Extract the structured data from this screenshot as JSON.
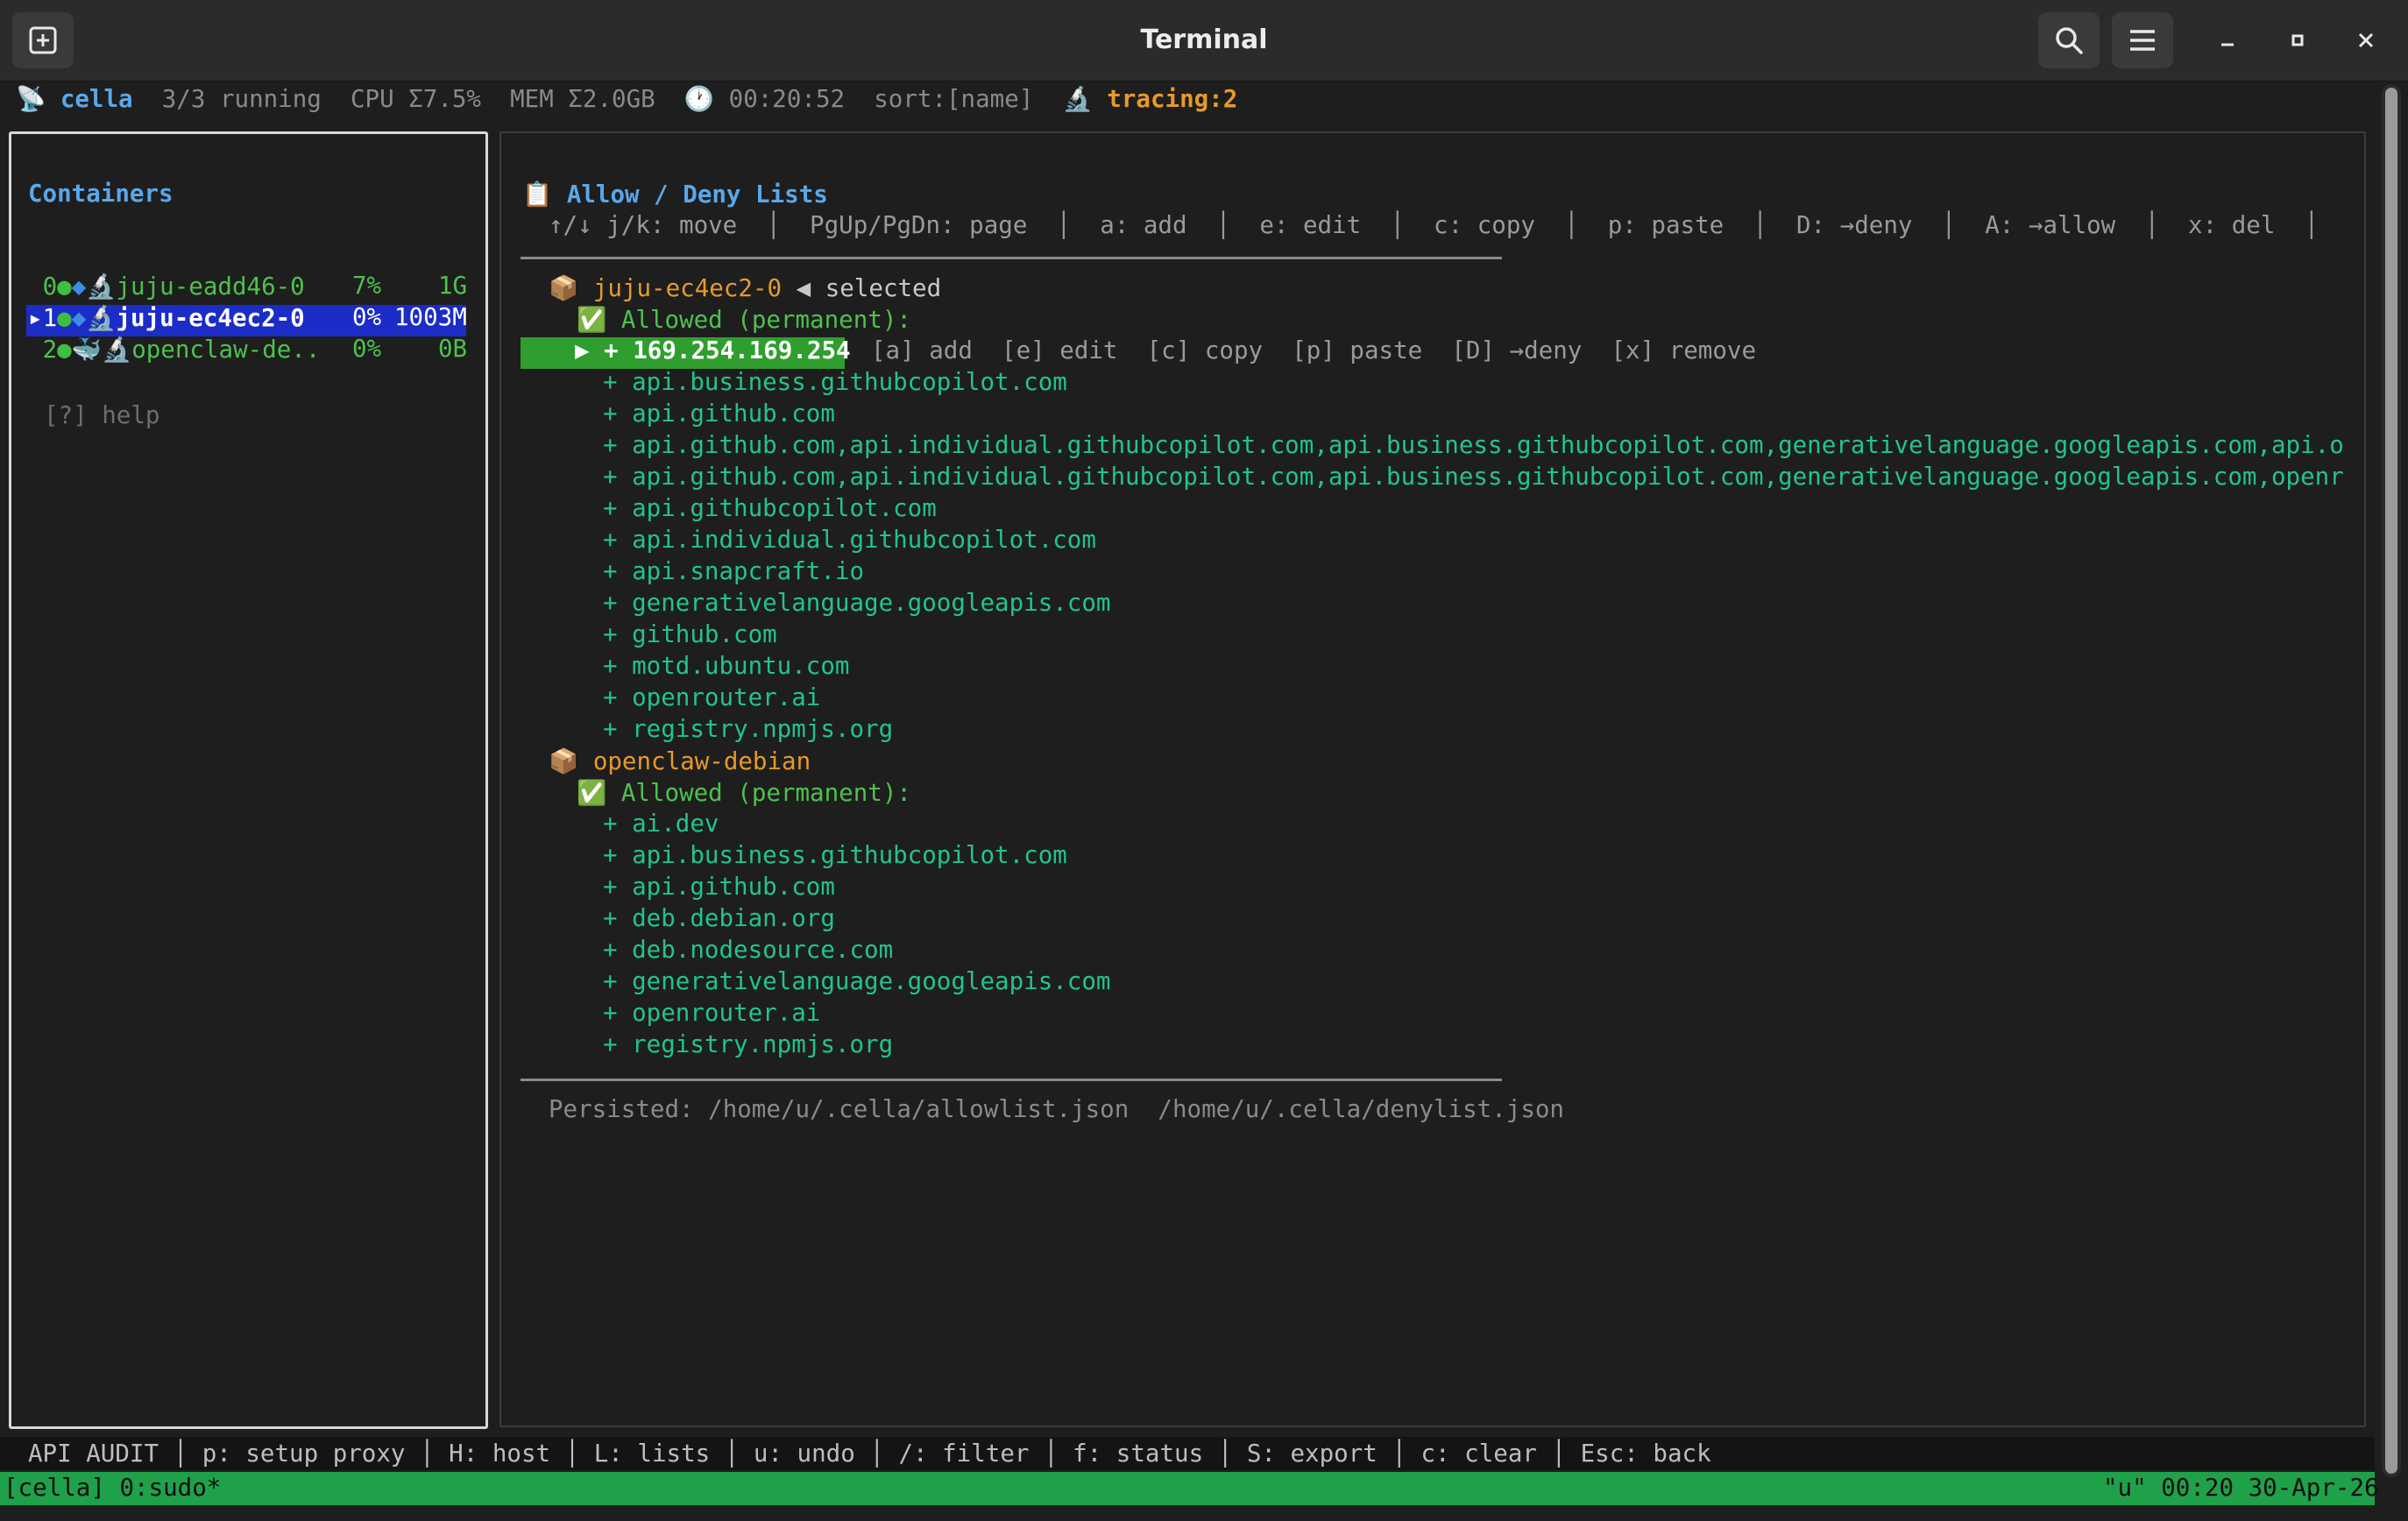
{
  "window": {
    "title": "Terminal",
    "new_tab_icon": "new-tab-icon",
    "search_icon": "search-icon",
    "menu_icon": "hamburger-menu-icon",
    "minimize_icon": "minimize-icon",
    "maximize_icon": "maximize-icon",
    "close_icon": "close-icon"
  },
  "status": {
    "app_icon": "📡",
    "app": "cella",
    "running": "3/3 running",
    "cpu": "CPU Σ7.5%",
    "mem": "MEM Σ2.0GB",
    "clock_icon": "🕐",
    "uptime": "00:20:52",
    "sort": "sort:[name]",
    "tracing_icon": "🔬",
    "tracing": "tracing:2"
  },
  "sidebar": {
    "title": "Containers",
    "containers": [
      {
        "index": "0",
        "name": "juju-eadd46-0",
        "cpu": "7%",
        "mem": "1G",
        "selected": false
      },
      {
        "index": "1",
        "name": "juju-ec4ec2-0",
        "cpu": "0%",
        "mem": "1003M",
        "selected": true,
        "marker": "▸"
      },
      {
        "index": "2",
        "name": "openclaw-de..",
        "cpu": "0%",
        "mem": "0B",
        "selected": false
      }
    ],
    "help": "[?] help"
  },
  "panel": {
    "title_icon": "📋",
    "title": "Allow / Deny Lists",
    "hints": [
      "↑/↓ j/k: move",
      "PgUp/PgDn: page",
      "a: add",
      "e: edit",
      "c: copy",
      "p: paste",
      "D: →deny",
      "A: →allow",
      "x: del"
    ],
    "groups": [
      {
        "icon": "📦",
        "name": "juju-ec4ec2-0",
        "selected_marker": "◀ selected",
        "status_icon": "✅",
        "section": "Allowed (permanent):",
        "selected_entry": "+ 169.254.169.254",
        "selected_cursor": "▶",
        "entry_actions": [
          "[a] add",
          "[e] edit",
          "[c] copy",
          "[p] paste",
          "[D] →deny",
          "[x] remove"
        ],
        "entries": [
          "+ api.business.githubcopilot.com",
          "+ api.github.com",
          "+ api.github.com,api.individual.githubcopilot.com,api.business.githubcopilot.com,generativelanguage.googleapis.com,api.o",
          "+ api.github.com,api.individual.githubcopilot.com,api.business.githubcopilot.com,generativelanguage.googleapis.com,openr",
          "+ api.githubcopilot.com",
          "+ api.individual.githubcopilot.com",
          "+ api.snapcraft.io",
          "+ generativelanguage.googleapis.com",
          "+ github.com",
          "+ motd.ubuntu.com",
          "+ openrouter.ai",
          "+ registry.npmjs.org"
        ]
      },
      {
        "icon": "📦",
        "name": "openclaw-debian",
        "status_icon": "✅",
        "section": "Allowed (permanent):",
        "entries": [
          "+ ai.dev",
          "+ api.business.githubcopilot.com",
          "+ api.github.com",
          "+ deb.debian.org",
          "+ deb.nodesource.com",
          "+ generativelanguage.googleapis.com",
          "+ openrouter.ai",
          "+ registry.npmjs.org"
        ]
      }
    ],
    "persisted_label": "Persisted:",
    "persisted_paths": [
      "/home/u/.cella/allowlist.json",
      "/home/u/.cella/denylist.json"
    ]
  },
  "footer": {
    "keys": [
      "API AUDIT",
      "p: setup proxy",
      "H: host",
      "L: lists",
      "u: undo",
      "/: filter",
      "f: status",
      "S: export",
      "c: clear",
      "Esc: back"
    ]
  },
  "tmux": {
    "left": "[cella] 0:sudo*",
    "right": "\"u\" 00:20 30-Apr-26"
  },
  "colors": {
    "background": "#1e1e1e",
    "accent_blue": "#5aa7e8",
    "green": "#4cc24c",
    "mint": "#22c48a",
    "orange": "#e69a2a",
    "tmux_bar": "#1fa14a",
    "selected_row": "#1c2cc7"
  }
}
